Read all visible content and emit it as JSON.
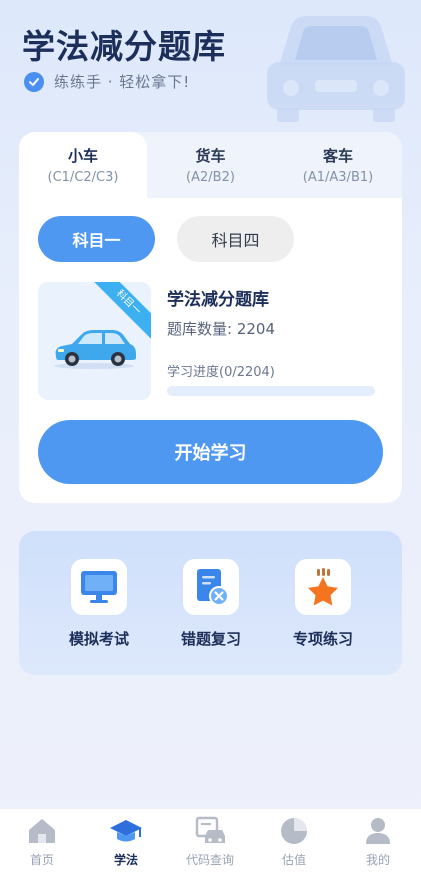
{
  "hero": {
    "title": "学法减分题库",
    "subtitle": "练练手 · 轻松拿下!"
  },
  "vehicle_tabs": [
    {
      "name": "小车",
      "code": "(C1/C2/C3)",
      "active": true
    },
    {
      "name": "货车",
      "code": "(A2/B2)",
      "active": false
    },
    {
      "name": "客车",
      "code": "(A1/A3/B1)",
      "active": false
    }
  ],
  "subjects": [
    {
      "label": "科目一",
      "active": true
    },
    {
      "label": "科目四",
      "active": false
    }
  ],
  "bank": {
    "ribbon": "科目一",
    "title": "学法减分题库",
    "count_text": "题库数量: 2204",
    "progress_text": "学习进度(0/2204)",
    "progress_value": 0
  },
  "start_button": "开始学习",
  "tools": [
    {
      "label": "模拟考试",
      "icon": "monitor-icon"
    },
    {
      "label": "错题复习",
      "icon": "wrong-doc-icon"
    },
    {
      "label": "专项练习",
      "icon": "star-icon"
    }
  ],
  "bottom_nav": [
    {
      "label": "首页",
      "icon": "home-icon",
      "active": false
    },
    {
      "label": "学法",
      "icon": "graduation-cap-icon",
      "active": true
    },
    {
      "label": "代码查询",
      "icon": "car-code-icon",
      "active": false
    },
    {
      "label": "估值",
      "icon": "pie-chart-icon",
      "active": false
    },
    {
      "label": "我的",
      "icon": "user-icon",
      "active": false
    }
  ],
  "colors": {
    "accent": "#4e98f2",
    "title": "#1c2f5a",
    "ribbon": "#3db0f2",
    "star": "#f5741f"
  }
}
